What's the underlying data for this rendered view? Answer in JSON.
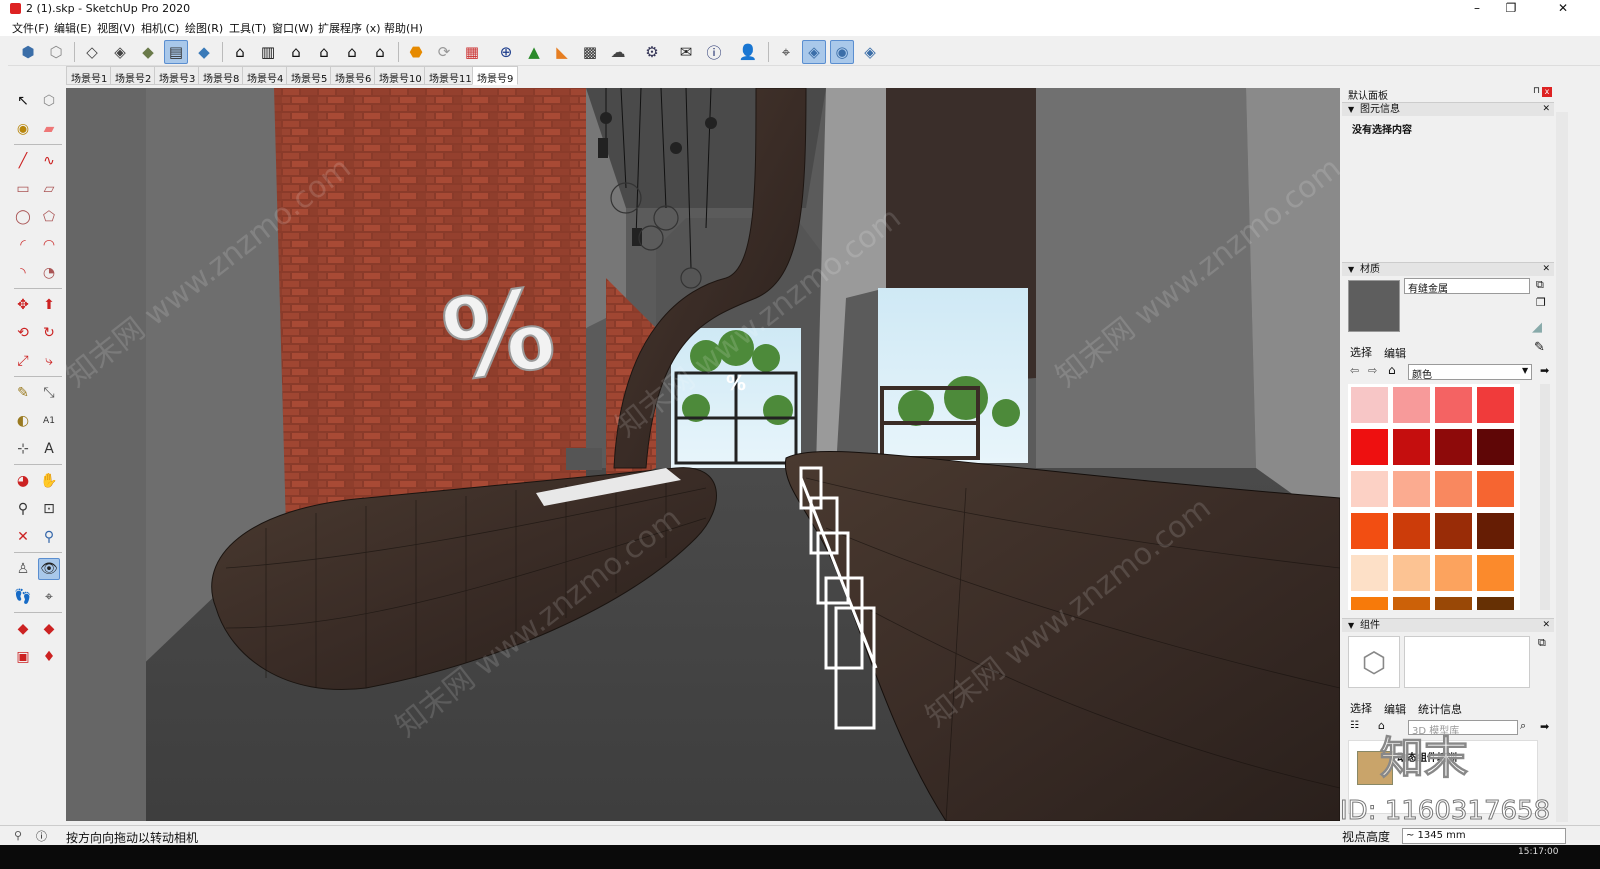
{
  "window": {
    "title": "2 (1).skp - SketchUp Pro 2020",
    "minimize": "–",
    "maximize": "❐",
    "close": "✕"
  },
  "menu": [
    "文件(F)",
    "编辑(E)",
    "视图(V)",
    "相机(C)",
    "绘图(R)",
    "工具(T)",
    "窗口(W)",
    "扩展程序 (x)",
    "帮助(H)"
  ],
  "scenes": [
    "场景号1",
    "场景号2",
    "场景号3",
    "场景号8",
    "场景号4",
    "场景号5",
    "场景号6",
    "场景号10",
    "场景号11",
    "场景号9"
  ],
  "selected_scene": "场景号9",
  "viewport": {
    "sign_text": "%",
    "small_sign_text": "%"
  },
  "tray": {
    "title": "默认面板",
    "entity_info": {
      "header": "图元信息",
      "status": "没有选择内容"
    },
    "materials": {
      "header": "材质",
      "material_name": "有缝金属",
      "tab_select": "选择",
      "tab_edit": "编辑",
      "library": "颜色",
      "swatches": [
        "#f7c6c6",
        "#f79a9a",
        "#f46363",
        "#f03b3b",
        "#ee1010",
        "#c50e0e",
        "#8e0a0a",
        "#5f0606",
        "#fcd1c5",
        "#fbab90",
        "#f9885f",
        "#f66531",
        "#f24e12",
        "#cc3c0a",
        "#992c07",
        "#661d04",
        "#fde0c7",
        "#fcc393",
        "#fca35e",
        "#fb8a2c",
        "#f77a0a",
        "#cc6108",
        "#994806",
        "#663004"
      ]
    },
    "components": {
      "header": "组件",
      "tab_select": "选择",
      "tab_edit": "编辑",
      "tab_stats": "统计信息",
      "search_placeholder": "3D 模型库",
      "folder_label": "动态组件培训"
    }
  },
  "status": {
    "hint": "按方向向拖动以转动相机",
    "measure_label": "视点高度",
    "measure_value": "~ 1345 mm"
  },
  "watermark": {
    "text": "知末网 www.znzmo.com",
    "logo": "知末",
    "id": "ID: 1160317658"
  },
  "clock": "15:17:00"
}
